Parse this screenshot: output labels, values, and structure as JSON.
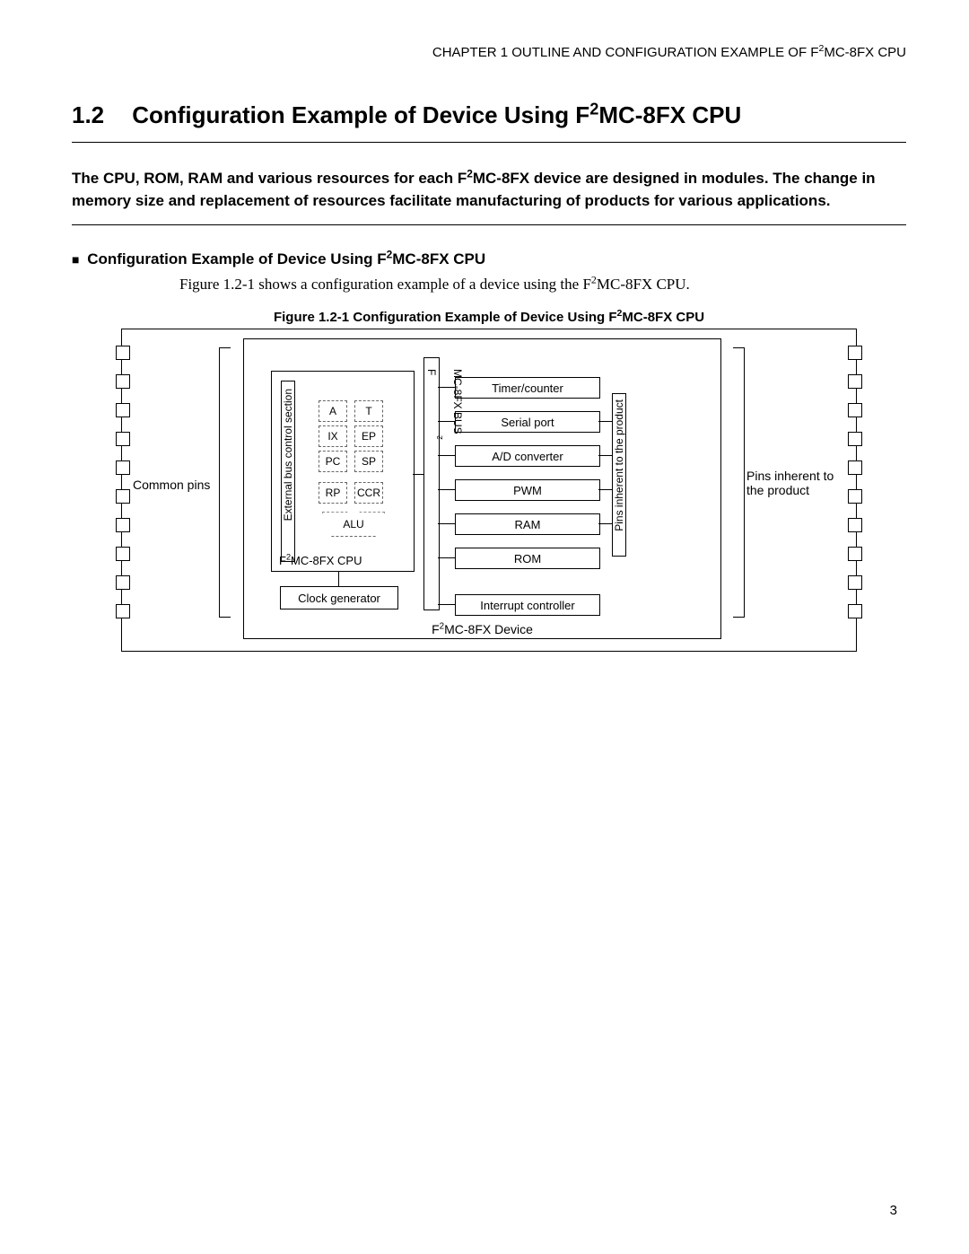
{
  "header": {
    "chapter": "CHAPTER 1  OUTLINE AND CONFIGURATION EXAMPLE OF F",
    "chapter_sup": "2",
    "chapter_tail": "MC-8FX CPU"
  },
  "section": {
    "number": "1.2",
    "title_pre": "Configuration Example of Device Using F",
    "title_sup": "2",
    "title_post": "MC-8FX CPU"
  },
  "intro": {
    "line1_pre": "The CPU, ROM, RAM and various resources for each F",
    "line1_sup": "2",
    "line1_post": "MC-8FX device are designed in modules. The change in memory size and replacement of resources facilitate manufacturing of products for various applications."
  },
  "subheading": {
    "marker": "■",
    "text_pre": "Configuration Example of Device Using F",
    "text_sup": "2",
    "text_post": "MC-8FX CPU"
  },
  "caption_line": {
    "pre": "Figure 1.2-1 shows a configuration example of a device using the F",
    "sup": "2",
    "post": "MC-8FX CPU."
  },
  "figure": {
    "caption_pre": "Figure 1.2-1  Configuration Example of Device Using F",
    "caption_sup": "2",
    "caption_post": "MC-8FX CPU",
    "common_pins": "Common pins",
    "pins_inherent": "Pins inherent to the product",
    "device_label_pre": "F",
    "device_label_sup": "2",
    "device_label_post": "MC-8FX Device",
    "cpu_label_pre": "F",
    "cpu_label_sup": "2",
    "cpu_label_post": "MC-8FX CPU",
    "ext_bus": "External bus control section",
    "bus_pre": "F",
    "bus_sup": "2",
    "bus_post": "MC-8FX BUS",
    "pins_vert": "Pins inherent to the product",
    "regs": {
      "A": "A",
      "T": "T",
      "IX": "IX",
      "EP": "EP",
      "PC": "PC",
      "SP": "SP",
      "RP": "RP",
      "CCR": "CCR",
      "ALU": "ALU"
    },
    "clock": "Clock generator",
    "resources": [
      "Timer/counter",
      "Serial port",
      "A/D converter",
      "PWM",
      "RAM",
      "ROM",
      "Interrupt controller"
    ]
  },
  "page_number": "3"
}
